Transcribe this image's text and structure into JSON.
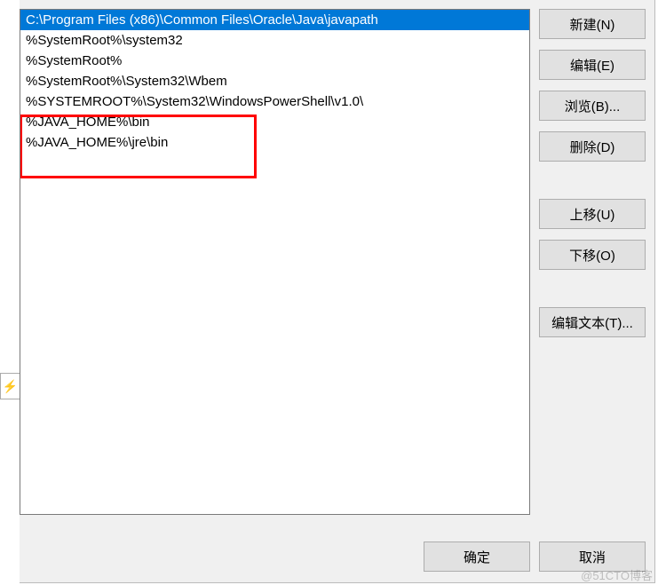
{
  "path_list": {
    "items": [
      "C:\\Program Files (x86)\\Common Files\\Oracle\\Java\\javapath",
      "%SystemRoot%\\system32",
      "%SystemRoot%",
      "%SystemRoot%\\System32\\Wbem",
      "%SYSTEMROOT%\\System32\\WindowsPowerShell\\v1.0\\",
      "%JAVA_HOME%\\bin",
      "%JAVA_HOME%\\jre\\bin"
    ],
    "selected_index": 0
  },
  "buttons": {
    "new": "新建(N)",
    "edit": "编辑(E)",
    "browse": "浏览(B)...",
    "delete": "删除(D)",
    "move_up": "上移(U)",
    "move_down": "下移(O)",
    "edit_text": "编辑文本(T)...",
    "ok": "确定",
    "cancel": "取消"
  },
  "lightning_glyph": "⚡",
  "watermark": "@51CTO博客"
}
